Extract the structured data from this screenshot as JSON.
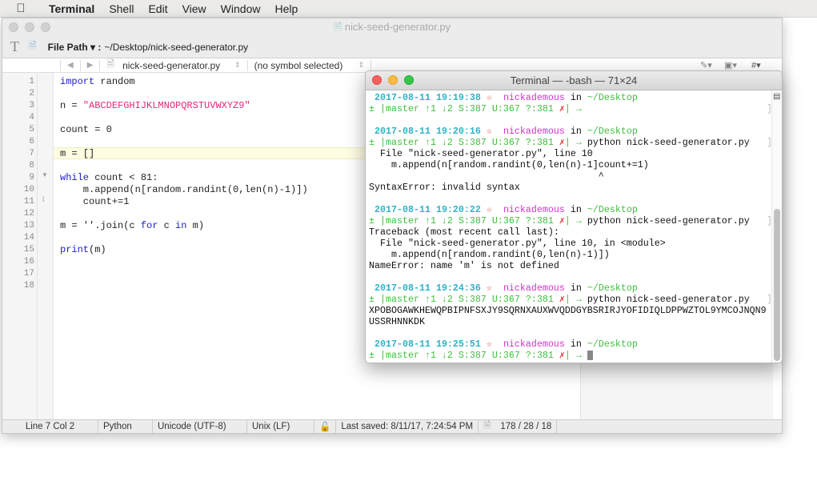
{
  "menubar": {
    "apple": "",
    "items": [
      "Terminal",
      "Shell",
      "Edit",
      "View",
      "Window",
      "Help"
    ]
  },
  "editor": {
    "title": "nick-seed-generator.py",
    "toolbar": {
      "file_path_label": "File Path ▾ :",
      "file_path": "~/Desktop/nick-seed-generator.py"
    },
    "nav": {
      "file": "nick-seed-generator.py",
      "symbol": "(no symbol selected)"
    },
    "lines": [
      "1",
      "2",
      "3",
      "4",
      "5",
      "6",
      "7",
      "8",
      "9",
      "10",
      "11",
      "12",
      "13",
      "14",
      "15",
      "16",
      "17",
      "18"
    ],
    "current_line": 7,
    "status": {
      "position": "Line 7 Col 2",
      "language": "Python",
      "encoding": "Unicode (UTF-8)",
      "line_endings": "Unix (LF)",
      "last_saved": "Last saved: 8/11/17, 7:24:54 PM",
      "counts": "178 / 28 / 18"
    }
  },
  "code": {
    "l1a": "import",
    "l1b": " random",
    "l3a": "n = ",
    "l3b": "\"ABCDEFGHIJKLMNOPQRSTUVWXYZ9\"",
    "l5": "count = 0",
    "l7": "m = []",
    "l9a": "while",
    "l9b": " count < 81:",
    "l10": "    m.append(n[random.randint(0,len(n)-1)])",
    "l11": "    count+=1",
    "l13a": "m = ''.join(c ",
    "l13b": "for",
    "l13c": " c ",
    "l13d": "in",
    "l13e": " m)",
    "l15a": "print",
    "l15b": "(m)"
  },
  "terminal": {
    "title": "Terminal — -bash — 71×24",
    "user": "nickademous",
    "in": " in ",
    "dir": "~/Desktop",
    "star": "☆",
    "git": "± |master ↑1 ↓2 S:387 U:367 ?:381 ",
    "x": "✗",
    "arrow": "| →",
    "cmd": " python nick-seed-generator.py",
    "t1": "2017-08-11 19:19:38",
    "t2": "2017-08-11 19:20:16",
    "t3": "2017-08-11 19:20:22",
    "t4": "2017-08-11 19:24:36",
    "t5": "2017-08-11 19:25:51",
    "o2": [
      "  File \"nick-seed-generator.py\", line 10",
      "    m.append(n[random.randint(0,len(n)-1]count+=1)",
      "                                         ^",
      "SyntaxError: invalid syntax"
    ],
    "o3": [
      "Traceback (most recent call last):",
      "  File \"nick-seed-generator.py\", line 10, in <module>",
      "    m.append(n[random.randint(0,len(n)-1)])",
      "NameError: name 'm' is not defined"
    ],
    "o4": [
      "XPOBOGAWKHEWQPBIPNFSXJY9SQRNXAUXWVQDDGYBSRIRJYOFIDIQLDPPWZTOL9YMCOJNQN9",
      "USSRHNNKDK"
    ]
  },
  "colors": {
    "timestamp": "#2fb3c6",
    "user": "#d133c8",
    "git": "#3fbf3f",
    "error_mark": "#dd3333",
    "keyword": "#1c1cc9",
    "string": "#e4287c"
  }
}
